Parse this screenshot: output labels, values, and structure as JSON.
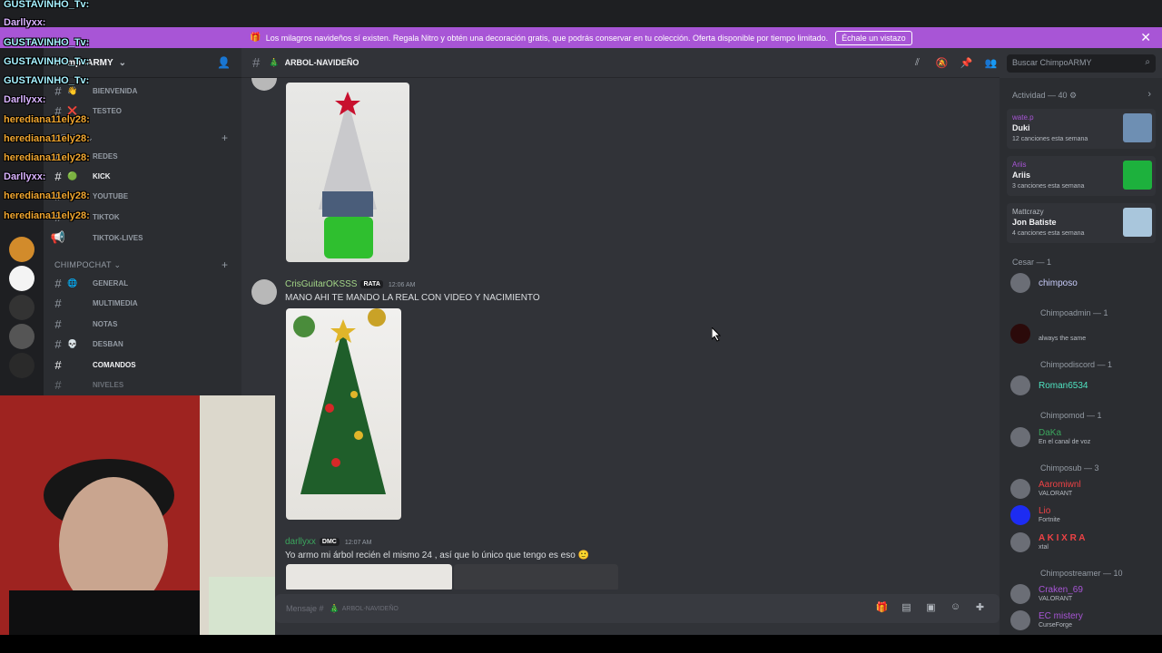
{
  "banner": {
    "text": "Los milagros navideños sí existen. Regala Nitro y obtén una decoración gratis, que podrás conservar en tu colección. Oferta disponible por tiempo limitado.",
    "button": "Échale un vistazo"
  },
  "guild": {
    "name": "ChimpoARMY"
  },
  "channel_list": {
    "top_channels": [
      {
        "label": "BIENVENIDA",
        "emoji": "👋"
      },
      {
        "label": "TESTEO",
        "emoji": "❌"
      }
    ],
    "categories": [
      {
        "label": "REDES",
        "channels": [
          {
            "label": "REDES",
            "emoji": ""
          },
          {
            "label": "KICK",
            "emoji": "🟢"
          },
          {
            "label": "YOUTUBE",
            "emoji": ""
          },
          {
            "label": "TIKTOK",
            "emoji": ""
          },
          {
            "label": "TIKTOK-LIVES",
            "emoji": ""
          }
        ]
      },
      {
        "label": "CHIMPOCHAT",
        "channels": [
          {
            "label": "GENERAL",
            "emoji": "🌐"
          },
          {
            "label": "MULTIMEDIA",
            "emoji": ""
          },
          {
            "label": "NOTAS",
            "emoji": ""
          },
          {
            "label": "DESBAN",
            "emoji": "💀"
          },
          {
            "label": "COMANDOS",
            "emoji": ""
          },
          {
            "label": "NIVELES",
            "emoji": ""
          }
        ]
      }
    ]
  },
  "chat": {
    "channel_name": "ARBOL-NAVIDEÑO",
    "search_placeholder": "Buscar ChimpoARMY",
    "messages": [
      {
        "author": "CrisGuitarOKSSS",
        "badge": "RATA",
        "time": "12:06 AM",
        "text": "MANO AHI TE MANDO LA REAL CON VIDEO Y NACIMIENTO"
      },
      {
        "author": "darllyxx",
        "badge": "DMC",
        "time": "12:07 AM",
        "text": "Yo armo mi árbol recién el mismo 24 , así que lo único que tengo es eso 🙂"
      }
    ],
    "composer_placeholder": "Mensaje #",
    "composer_channel": "ARBOL-NAVIDEÑO"
  },
  "members": {
    "activity_title": "Actividad — 40",
    "activity": [
      {
        "user": "wate.p",
        "title": "Duki",
        "sub": "12 canciones esta semana"
      },
      {
        "user": "Ariis",
        "title": "Ariis",
        "sub": "3 canciones esta semana"
      },
      {
        "user": "Mattcrazy",
        "title": "Jon Batiste",
        "sub": "4 canciones esta semana"
      }
    ],
    "groups": [
      {
        "role": "Cesar — 1",
        "members": [
          {
            "name": "chimposo",
            "sub": "",
            "color": "#c9cdfb"
          }
        ]
      },
      {
        "role": "Chimpoadmin — 1",
        "members": [
          {
            "name": "",
            "sub": "always the same",
            "color": "#ed4245"
          }
        ]
      },
      {
        "role": "Chimpodiscord — 1",
        "members": [
          {
            "name": "Roman6534",
            "sub": "",
            "color": "#4fe3c1"
          }
        ]
      },
      {
        "role": "Chimpomod — 1",
        "members": [
          {
            "name": "DaKa",
            "sub": "En el canal de voz",
            "color": "#3ba55d"
          }
        ]
      },
      {
        "role": "Chimposub — 3",
        "members": [
          {
            "name": "Aaromiwnl",
            "sub": "VALORANT",
            "color": "#ed4245"
          },
          {
            "name": "Lio",
            "sub": "Fortnite",
            "color": "#ed4245"
          },
          {
            "name": "A K I X R A",
            "sub": "xtal",
            "color": "#ed4245"
          }
        ]
      },
      {
        "role": "Chimpostreamer — 10",
        "members": [
          {
            "name": "Craken_69",
            "sub": "VALORANT",
            "color": "#a855d6"
          },
          {
            "name": "EC mistery",
            "sub": "CurseForge",
            "color": "#a855d6"
          }
        ]
      }
    ]
  },
  "overlay_names": [
    {
      "text": "GUSTAVINHO_Tv:",
      "kind": "gus"
    },
    {
      "text": "Darllyxx:",
      "kind": "dar"
    },
    {
      "text": "GUSTAVINHO_Tv:",
      "kind": "gus"
    },
    {
      "text": "GUSTAVINHO_Tv:",
      "kind": "gus"
    },
    {
      "text": "GUSTAVINHO_Tv:",
      "kind": "gus"
    },
    {
      "text": "Darllyxx:",
      "kind": "dar"
    },
    {
      "text": "herediana11ely28:",
      "kind": "her"
    },
    {
      "text": "herediana11ely28:",
      "kind": "her"
    },
    {
      "text": "herediana11ely28:",
      "kind": "her"
    },
    {
      "text": "Darllyxx:",
      "kind": "dar"
    },
    {
      "text": "herediana11ely28:",
      "kind": "her"
    },
    {
      "text": "herediana11ely28:",
      "kind": "her"
    }
  ],
  "colors": {
    "banner": "#a855d6",
    "cris": "#a3d687",
    "darllyxx": "#3ba55d"
  }
}
